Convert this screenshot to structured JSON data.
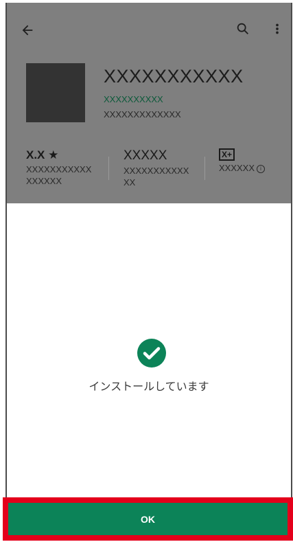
{
  "header": {
    "back_icon": "arrow-left-icon",
    "search_icon": "search-icon",
    "more_icon": "more-vert-icon"
  },
  "app": {
    "title": "XXXXXXXXXXX",
    "developer": "XXXXXXXXXX",
    "subtitle": "XXXXXXXXXXXXX"
  },
  "stats": [
    {
      "value": "X.X ★",
      "label": "XXXXXXXXXXX XXXXXX"
    },
    {
      "value": "XXXXX",
      "label": "XXXXXXXXXXX XX"
    },
    {
      "value": "X+",
      "label": "XXXXXX"
    }
  ],
  "install": {
    "status": "インストールしています",
    "icon": "check-circle-icon",
    "color": "#0c8358"
  },
  "footer": {
    "ok_label": "OK",
    "highlight_color": "#e4001b"
  }
}
